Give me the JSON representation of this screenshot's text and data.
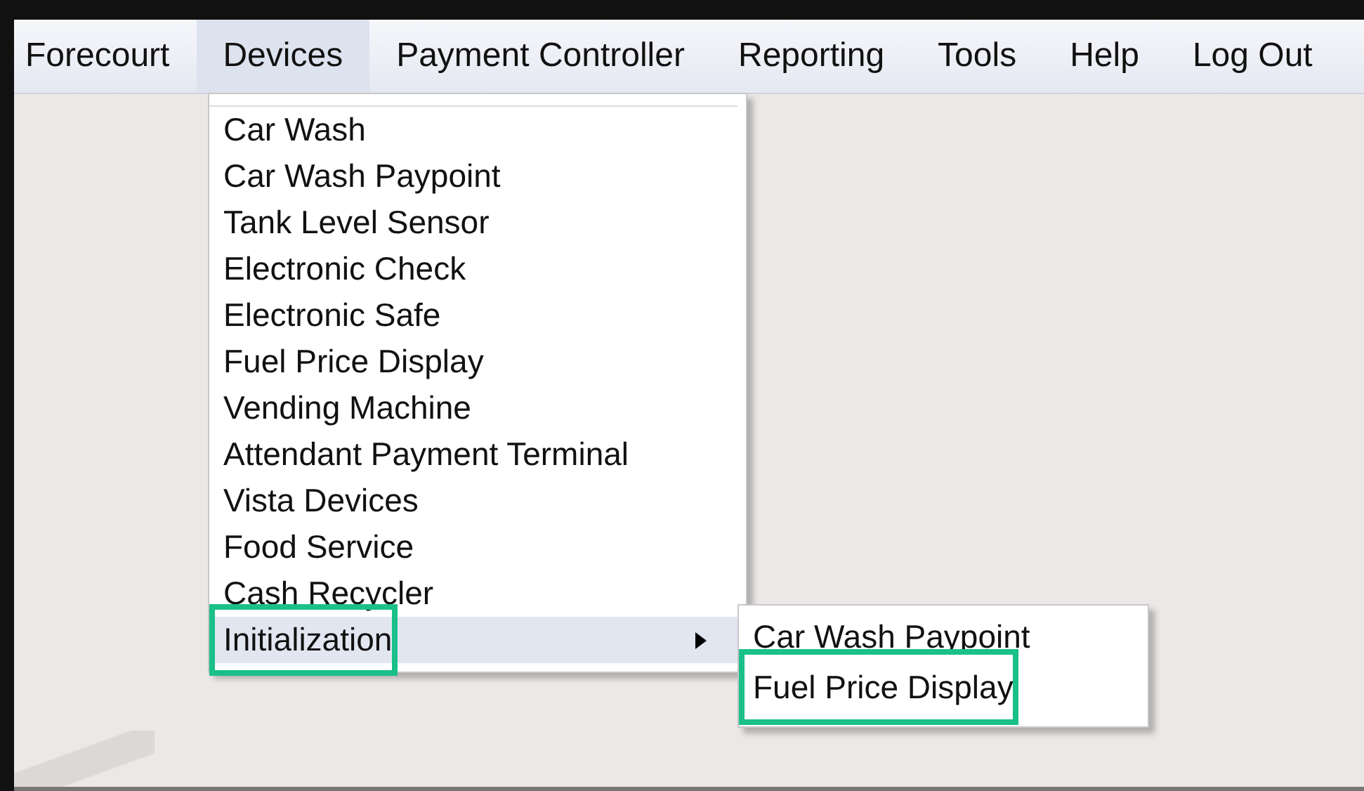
{
  "menu_bar": [
    {
      "label": "Forecourt",
      "selected": false
    },
    {
      "label": "Devices",
      "selected": true
    },
    {
      "label": "Payment Controller",
      "selected": false
    },
    {
      "label": "Reporting",
      "selected": false
    },
    {
      "label": "Tools",
      "selected": false
    },
    {
      "label": "Help",
      "selected": false
    },
    {
      "label": "Log Out",
      "selected": false
    }
  ],
  "dropdown": {
    "items": [
      {
        "label": "Car Wash",
        "selected": false,
        "has_submenu": false,
        "callout": false
      },
      {
        "label": "Car Wash Paypoint",
        "selected": false,
        "has_submenu": false,
        "callout": false
      },
      {
        "label": "Tank Level Sensor",
        "selected": false,
        "has_submenu": false,
        "callout": false
      },
      {
        "label": "Electronic Check",
        "selected": false,
        "has_submenu": false,
        "callout": false
      },
      {
        "label": "Electronic Safe",
        "selected": false,
        "has_submenu": false,
        "callout": false
      },
      {
        "label": "Fuel Price Display",
        "selected": false,
        "has_submenu": false,
        "callout": false
      },
      {
        "label": "Vending Machine",
        "selected": false,
        "has_submenu": false,
        "callout": false
      },
      {
        "label": "Attendant Payment Terminal",
        "selected": false,
        "has_submenu": false,
        "callout": false
      },
      {
        "label": "Vista Devices",
        "selected": false,
        "has_submenu": false,
        "callout": false
      },
      {
        "label": "Food Service",
        "selected": false,
        "has_submenu": false,
        "callout": false
      },
      {
        "label": "Cash Recycler",
        "selected": false,
        "has_submenu": false,
        "callout": false
      },
      {
        "label": "Initialization",
        "selected": true,
        "has_submenu": true,
        "callout": true
      }
    ]
  },
  "submenu": {
    "items": [
      {
        "label": "Car Wash Paypoint",
        "selected": false,
        "callout": false
      },
      {
        "label": "Fuel Price Display",
        "selected": false,
        "callout": true
      }
    ]
  }
}
